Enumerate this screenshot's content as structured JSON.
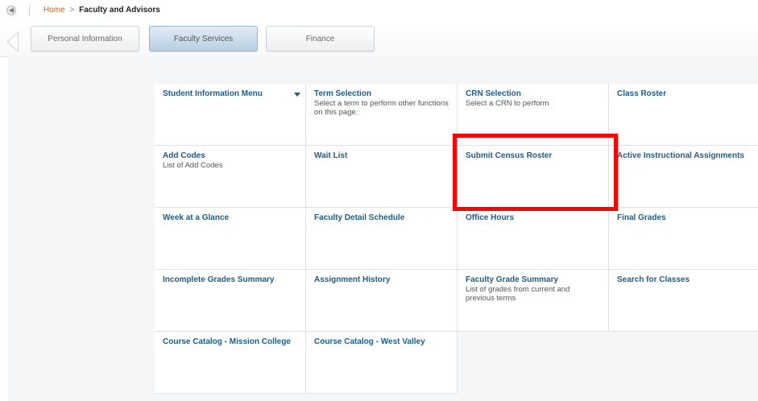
{
  "breadcrumb": {
    "home": "Home",
    "separator": ">",
    "current": "Faculty and Advisors"
  },
  "icons": {
    "back": "back-arrow-icon",
    "tab_prev": "chevron-left-icon",
    "dropdown": "caret-down-icon"
  },
  "tabs": [
    {
      "label": "Personal Information",
      "active": false
    },
    {
      "label": "Faculty Services",
      "active": true
    },
    {
      "label": "Finance",
      "active": false
    }
  ],
  "tiles": [
    {
      "title": "Student Information Menu",
      "desc": "",
      "dropdown": true
    },
    {
      "title": "Term Selection",
      "desc": "Select a term to perform other functions on this page."
    },
    {
      "title": "CRN Selection",
      "desc": "Select a CRN to perform"
    },
    {
      "title": "Class Roster",
      "desc": ""
    },
    {
      "title": "Add Codes",
      "desc": "List of Add Codes"
    },
    {
      "title": "Wait List",
      "desc": ""
    },
    {
      "title": "Submit Census Roster",
      "desc": ""
    },
    {
      "title": "Active Instructional Assignments",
      "desc": ""
    },
    {
      "title": "Week at a Glance",
      "desc": ""
    },
    {
      "title": "Faculty Detail Schedule",
      "desc": ""
    },
    {
      "title": "Office Hours",
      "desc": ""
    },
    {
      "title": "Final Grades",
      "desc": ""
    },
    {
      "title": "Incomplete Grades Summary",
      "desc": ""
    },
    {
      "title": "Assignment History",
      "desc": ""
    },
    {
      "title": "Faculty Grade Summary",
      "desc": "List of grades from current and previous terms"
    },
    {
      "title": "Search for Classes",
      "desc": ""
    },
    {
      "title": "Course Catalog - Mission College",
      "desc": ""
    },
    {
      "title": "Course Catalog - West Valley",
      "desc": ""
    }
  ],
  "colors": {
    "link_orange": "#c8641e",
    "tile_title_blue": "#1f5c8c",
    "active_tab": "#b7cfe2",
    "highlight_red": "#ff0000"
  }
}
